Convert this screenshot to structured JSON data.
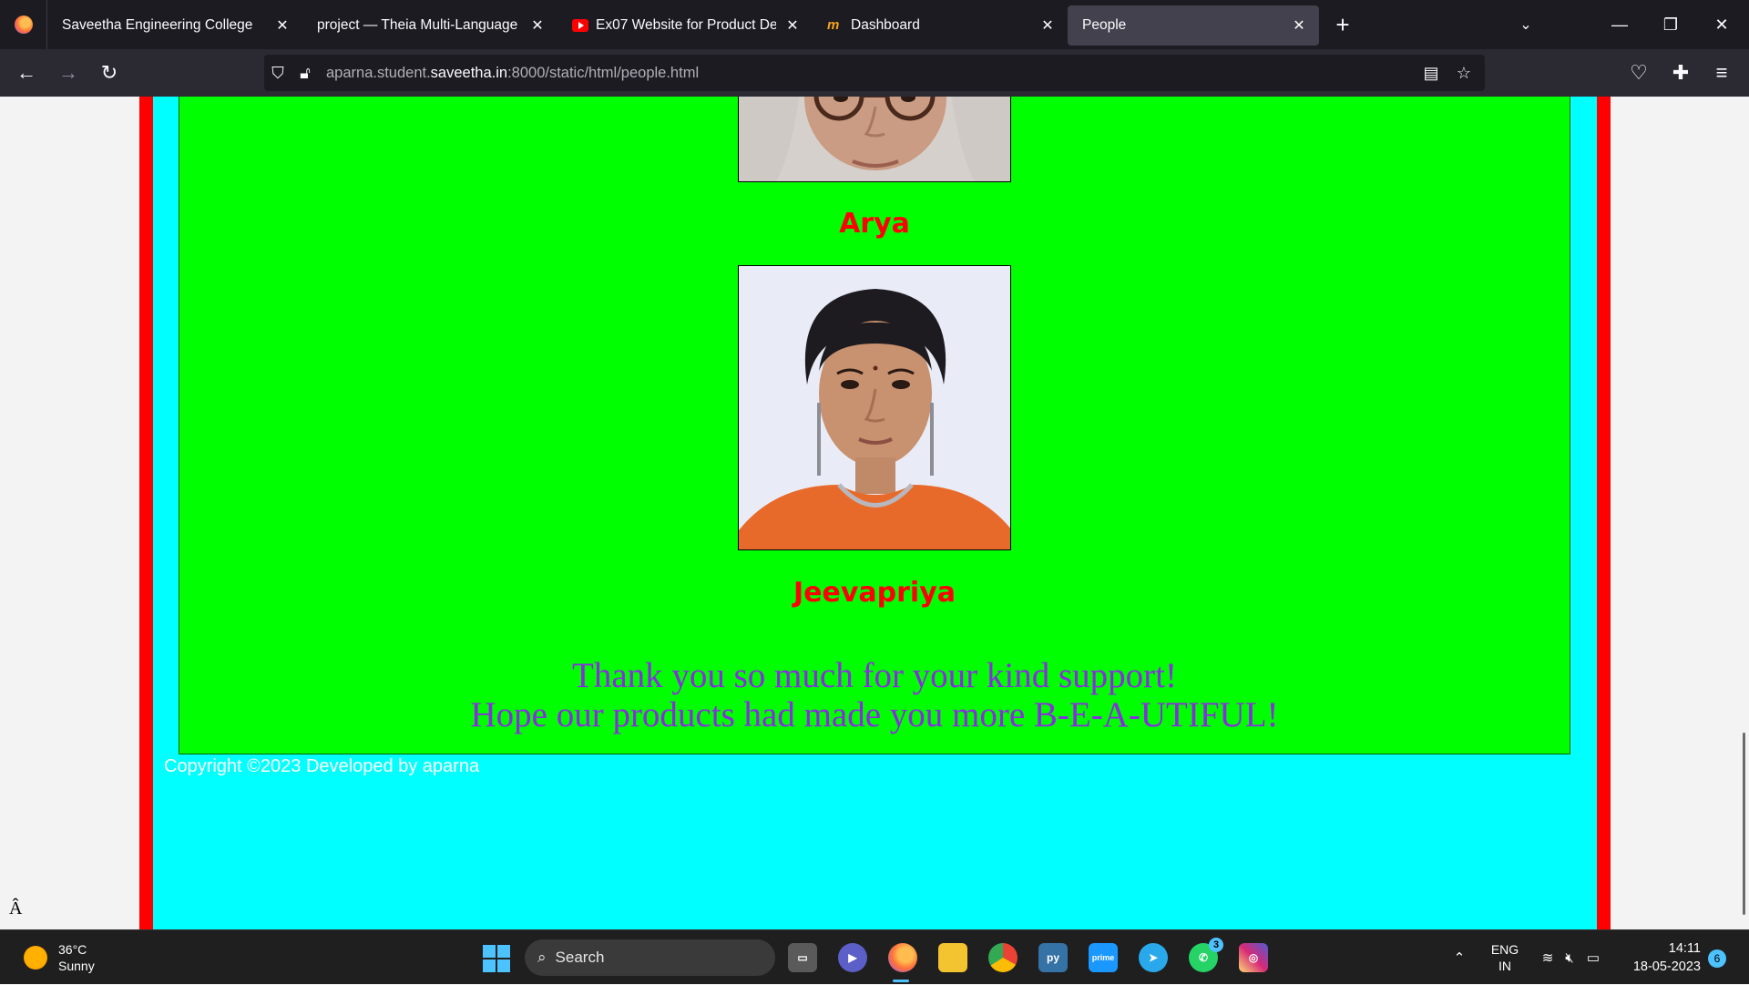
{
  "browser": {
    "tabs": [
      {
        "title": "Saveetha Engineering College",
        "favicon": "none",
        "active": false
      },
      {
        "title": "project — Theia Multi-Language Ex",
        "favicon": "none",
        "active": false
      },
      {
        "title": "Ex07 Website for Product Devel",
        "favicon": "youtube-icon",
        "active": false
      },
      {
        "title": "Dashboard",
        "favicon": "moodle-icon",
        "active": false
      },
      {
        "title": "People",
        "favicon": "none",
        "active": true
      }
    ],
    "url": {
      "prefix": "aparna.student.",
      "host": "saveetha.in",
      "suffix": ":8000/static/html/people.html"
    }
  },
  "page": {
    "people": [
      {
        "name": "Arya"
      },
      {
        "name": "Jeevapriya"
      }
    ],
    "thanks_line1": "Thank you so much for your kind support!",
    "thanks_line2": "Hope our products had made you more B-E-A-UTIFUL!",
    "copyright": "Copyright ©2023 Developed by aparna",
    "stray_glyph": "Â",
    "colors": {
      "frame": "#ff0000",
      "outer": "#00ffff",
      "content": "#00ff00",
      "name": "#ff0000",
      "thanks": "#8a2be2"
    }
  },
  "taskbar": {
    "weather_temp": "36°C",
    "weather_desc": "Sunny",
    "search_label": "Search",
    "whatsapp_badge": "3",
    "lang_line1": "ENG",
    "lang_line2": "IN",
    "time": "14:11",
    "date": "18-05-2023",
    "notifications": "6"
  }
}
